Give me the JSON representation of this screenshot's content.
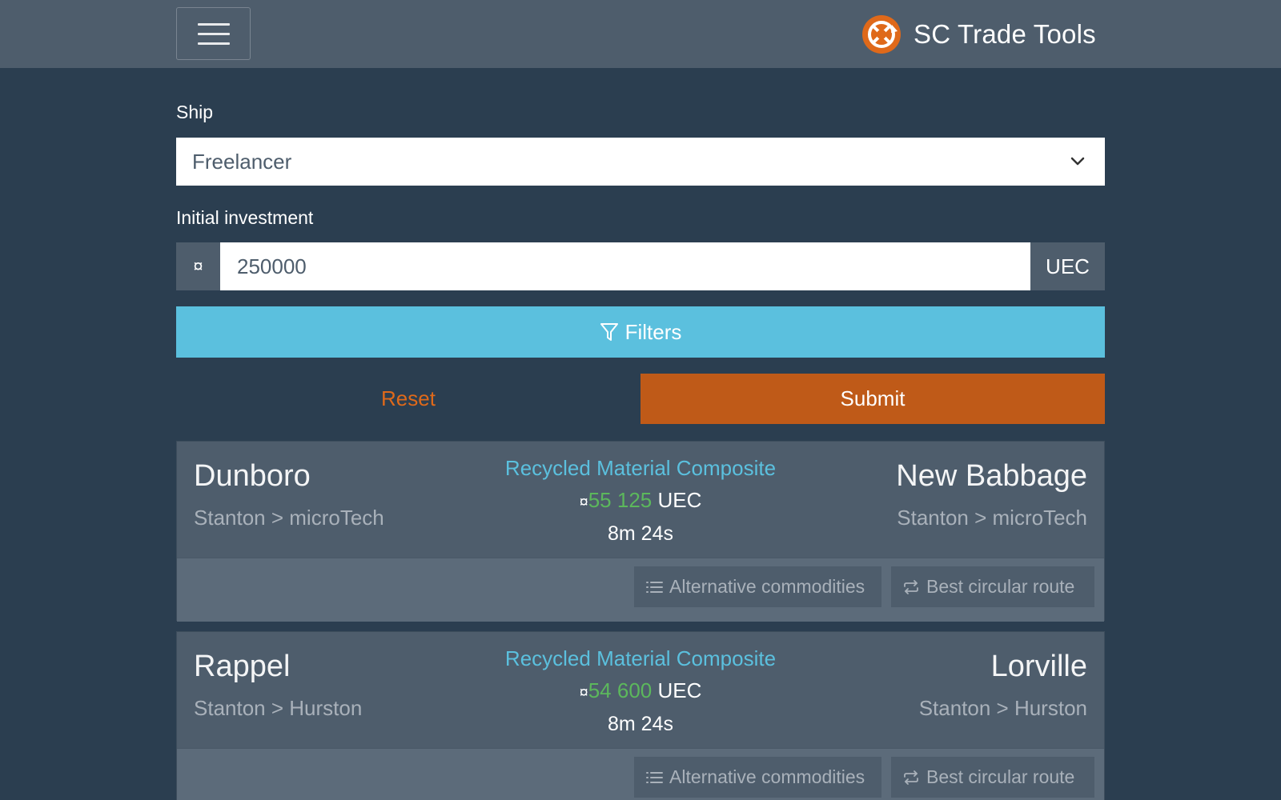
{
  "navbar": {
    "brand_title": "SC Trade Tools"
  },
  "form": {
    "ship_label": "Ship",
    "ship_value": "Freelancer",
    "investment_label": "Initial investment",
    "currency_symbol": "¤",
    "investment_value": "250000",
    "currency_unit": "UEC",
    "filters_label": "Filters",
    "reset_label": "Reset",
    "submit_label": "Submit"
  },
  "routes": [
    {
      "origin": "Dunboro",
      "origin_path": "Stanton > microTech",
      "commodity": "Recycled Material Composite",
      "currency_symbol": "¤",
      "profit": "55 125",
      "unit": "UEC",
      "duration": "8m 24s",
      "destination": "New Babbage",
      "destination_path": "Stanton > microTech",
      "alt_label": "Alternative commodities",
      "circular_label": "Best circular route"
    },
    {
      "origin": "Rappel",
      "origin_path": "Stanton > Hurston",
      "commodity": "Recycled Material Composite",
      "currency_symbol": "¤",
      "profit": "54 600",
      "unit": "UEC",
      "duration": "8m 24s",
      "destination": "Lorville",
      "destination_path": "Stanton > Hurston",
      "alt_label": "Alternative commodities",
      "circular_label": "Best circular route"
    }
  ],
  "colors": {
    "background": "#2b3e50",
    "navbar": "#4e5d6c",
    "accent_orange": "#df691a",
    "submit_orange": "#bf5a18",
    "info_blue": "#5bc0de",
    "profit_green": "#5cb85c",
    "muted_text": "#a9b1ba"
  },
  "icons": {
    "menu": "hamburger-icon",
    "logo": "sc-trade-tools-logo",
    "select": "chevron-down-icon",
    "filters": "filter-icon",
    "alternatives": "list-icon",
    "circular": "repeat-icon"
  }
}
